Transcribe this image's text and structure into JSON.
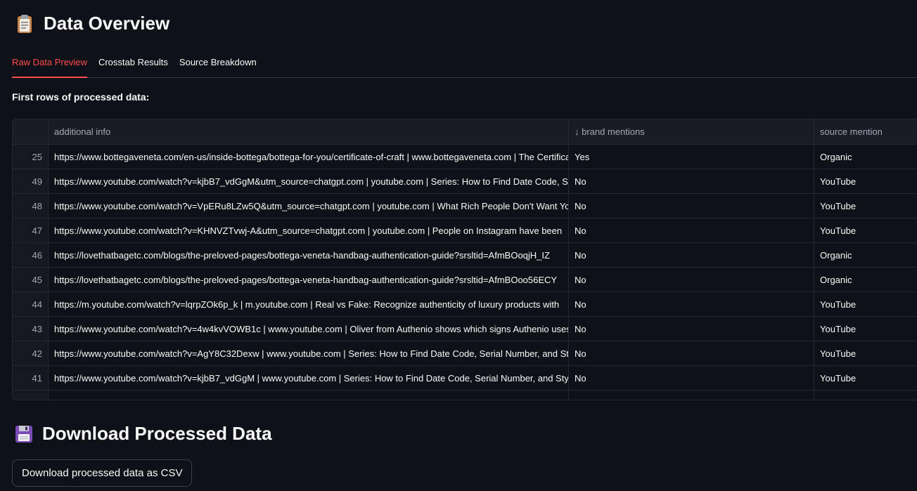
{
  "overview": {
    "emoji_icon": "clipboard-icon",
    "title": "Data Overview"
  },
  "tabs": [
    {
      "label": "Raw Data Preview",
      "active": true
    },
    {
      "label": "Crosstab Results",
      "active": false
    },
    {
      "label": "Source Breakdown",
      "active": false
    }
  ],
  "preview": {
    "caption": "First rows of processed data:",
    "columns": {
      "info": "additional info",
      "brand": "↓ brand mentions",
      "source": "source mention"
    },
    "rows": [
      {
        "index": "25",
        "info": "https://www.bottegaveneta.com/en-us/inside-bottega/bottega-for-you/certificate-of-craft | www.bottegaveneta.com | The Certificate of Craft",
        "brand": "Yes",
        "source": "Organic"
      },
      {
        "index": "49",
        "info": "https://www.youtube.com/watch?v=kjbB7_vdGgM&utm_source=chatgpt.com | youtube.com | Series: How to Find Date Code, Serial Number",
        "brand": "No",
        "source": "YouTube"
      },
      {
        "index": "48",
        "info": "https://www.youtube.com/watch?v=VpERu8LZw5Q&utm_source=chatgpt.com | youtube.com | What Rich People Don't Want You to Know",
        "brand": "No",
        "source": "YouTube"
      },
      {
        "index": "47",
        "info": "https://www.youtube.com/watch?v=KHNVZTvwj-A&utm_source=chatgpt.com | youtube.com | People on Instagram have been",
        "brand": "No",
        "source": "YouTube"
      },
      {
        "index": "46",
        "info": "https://lovethatbagetc.com/blogs/the-preloved-pages/bottega-veneta-handbag-authentication-guide?srsltid=AfmBOoqjH_IZ",
        "brand": "No",
        "source": "Organic"
      },
      {
        "index": "45",
        "info": "https://lovethatbagetc.com/blogs/the-preloved-pages/bottega-veneta-handbag-authentication-guide?srsltid=AfmBOoo56ECY",
        "brand": "No",
        "source": "Organic"
      },
      {
        "index": "44",
        "info": "https://m.youtube.com/watch?v=lqrpZOk6p_k | m.youtube.com | Real vs Fake: Recognize authenticity of luxury products with",
        "brand": "No",
        "source": "YouTube"
      },
      {
        "index": "43",
        "info": "https://www.youtube.com/watch?v=4w4kvVOWB1c | www.youtube.com | Oliver from Authenio shows which signs Authenio uses",
        "brand": "No",
        "source": "YouTube"
      },
      {
        "index": "42",
        "info": "https://www.youtube.com/watch?v=AgY8C32Dexw | www.youtube.com | Series: How to Find Date Code, Serial Number, and Style",
        "brand": "No",
        "source": "YouTube"
      },
      {
        "index": "41",
        "info": "https://www.youtube.com/watch?v=kjbB7_vdGgM | www.youtube.com | Series: How to Find Date Code, Serial Number, and Style",
        "brand": "No",
        "source": "YouTube"
      }
    ]
  },
  "download": {
    "emoji_icon": "floppy-disk-icon",
    "title": "Download Processed Data",
    "button_label": "Download processed data as CSV"
  }
}
